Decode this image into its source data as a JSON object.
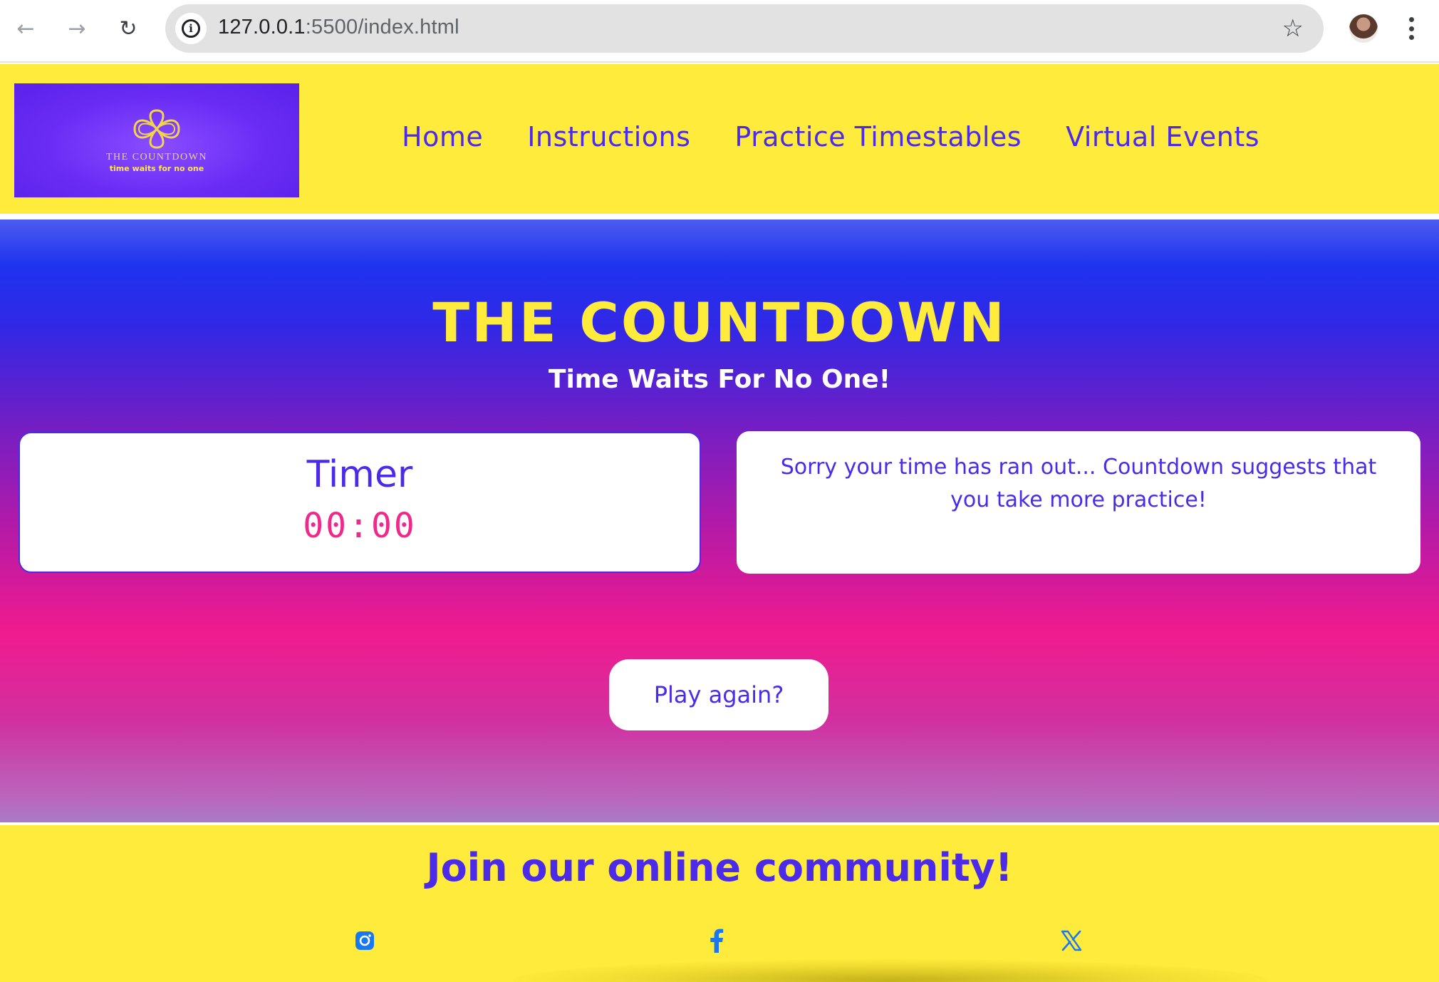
{
  "browser": {
    "url_host": "127.0.0.1",
    "url_path": ":5500/index.html",
    "icons": {
      "back": "arrow-left",
      "forward": "arrow-right",
      "reload": "reload",
      "site_info": "info",
      "bookmark": "star-outline",
      "profile": "avatar",
      "menu": "kebab"
    }
  },
  "header": {
    "logo": {
      "title": "THE COUNTDOWN",
      "tagline": "time waits for no one"
    },
    "nav": {
      "home": "Home",
      "instructions": "Instructions",
      "practice": "Practice Timestables",
      "events": "Virtual Events"
    }
  },
  "hero": {
    "title": "THE COUNTDOWN",
    "subtitle": "Time Waits For No One!"
  },
  "timer": {
    "label": "Timer",
    "value": "00:00"
  },
  "message": {
    "text": "Sorry your time has ran out... Countdown suggests that you take more practice!"
  },
  "play_again": {
    "label": "Play again?"
  },
  "footer": {
    "title": "Join our online community!",
    "socials": [
      "instagram-icon",
      "facebook-icon",
      "x-icon"
    ]
  },
  "colors": {
    "yellow": "#ffeb3b",
    "purple": "#4b2be8",
    "pink": "#f0288a",
    "blue": "#1e33ef",
    "social_blue": "#1877f2"
  }
}
